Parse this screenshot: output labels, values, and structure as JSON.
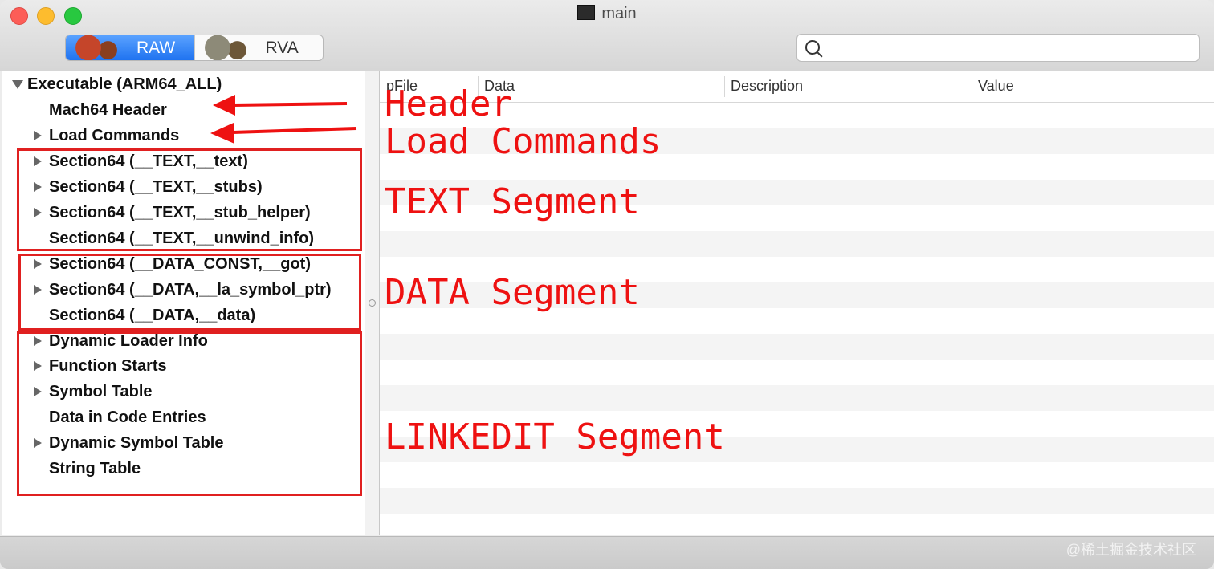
{
  "window": {
    "title": "main"
  },
  "toolbar": {
    "mode_options": [
      {
        "label": "RAW",
        "selected": true
      },
      {
        "label": "RVA",
        "selected": false
      }
    ],
    "search": {
      "value": "",
      "placeholder": ""
    }
  },
  "tree": {
    "items": [
      {
        "label": "Executable  (ARM64_ALL)",
        "expander": "expanded"
      },
      {
        "label": "Mach64 Header",
        "expander": "none"
      },
      {
        "label": "Load Commands",
        "expander": "collapsed"
      },
      {
        "label": "Section64 (__TEXT,__text)",
        "expander": "collapsed"
      },
      {
        "label": "Section64 (__TEXT,__stubs)",
        "expander": "collapsed"
      },
      {
        "label": "Section64 (__TEXT,__stub_helper)",
        "expander": "collapsed"
      },
      {
        "label": "Section64 (__TEXT,__unwind_info)",
        "expander": "none"
      },
      {
        "label": "Section64 (__DATA_CONST,__got)",
        "expander": "collapsed"
      },
      {
        "label": "Section64 (__DATA,__la_symbol_ptr)",
        "expander": "collapsed"
      },
      {
        "label": "Section64 (__DATA,__data)",
        "expander": "none"
      },
      {
        "label": "Dynamic Loader Info",
        "expander": "collapsed"
      },
      {
        "label": "Function Starts",
        "expander": "collapsed"
      },
      {
        "label": "Symbol Table",
        "expander": "collapsed"
      },
      {
        "label": "Data in Code Entries",
        "expander": "none"
      },
      {
        "label": "Dynamic Symbol Table",
        "expander": "collapsed"
      },
      {
        "label": "String Table",
        "expander": "none"
      }
    ]
  },
  "table": {
    "columns": [
      "pFile",
      "Data",
      "Description",
      "Value"
    ],
    "rows": []
  },
  "annotations": {
    "header": "Header",
    "load_commands": "Load Commands",
    "text_segment": "TEXT Segment",
    "data_segment": "DATA Segment",
    "linkedit_segment": "LINKEDIT Segment",
    "color": "#ee1111"
  },
  "watermark": "@稀土掘金技术社区",
  "colors": {
    "accent": "#1f73f0",
    "annotation": "#ee1111"
  }
}
